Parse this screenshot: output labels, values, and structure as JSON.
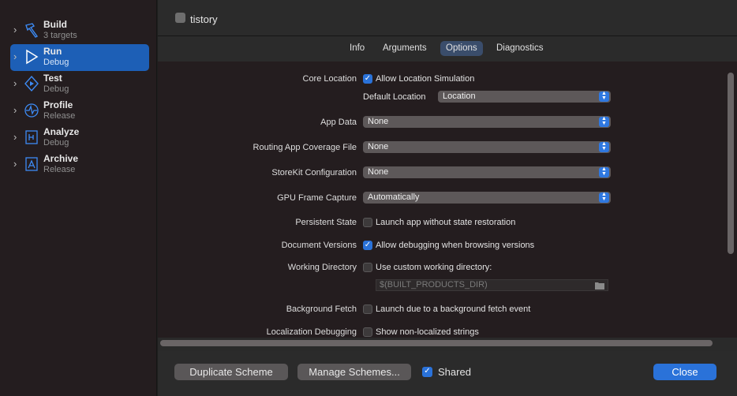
{
  "sidebar": {
    "items": [
      {
        "title": "Build",
        "subtitle": "3 targets",
        "icon": "hammer-icon"
      },
      {
        "title": "Run",
        "subtitle": "Debug",
        "icon": "play-icon"
      },
      {
        "title": "Test",
        "subtitle": "Debug",
        "icon": "test-diamond-icon"
      },
      {
        "title": "Profile",
        "subtitle": "Release",
        "icon": "waveform-icon"
      },
      {
        "title": "Analyze",
        "subtitle": "Debug",
        "icon": "analyze-icon"
      },
      {
        "title": "Archive",
        "subtitle": "Release",
        "icon": "archive-icon"
      }
    ]
  },
  "header": {
    "target_name": "tistory"
  },
  "tabs": [
    "Info",
    "Arguments",
    "Options",
    "Diagnostics"
  ],
  "active_tab": "Options",
  "options": {
    "core_location": {
      "label": "Core Location",
      "checkbox_label": "Allow Location Simulation",
      "checked": true
    },
    "default_location": {
      "label": "Default Location",
      "value": "Location"
    },
    "app_data": {
      "label": "App Data",
      "value": "None"
    },
    "routing": {
      "label": "Routing App Coverage File",
      "value": "None"
    },
    "storekit": {
      "label": "StoreKit Configuration",
      "value": "None"
    },
    "gpu": {
      "label": "GPU Frame Capture",
      "value": "Automatically"
    },
    "persistent": {
      "label": "Persistent State",
      "checkbox_label": "Launch app without state restoration",
      "checked": false
    },
    "document": {
      "label": "Document Versions",
      "checkbox_label": "Allow debugging when browsing versions",
      "checked": true
    },
    "working_dir": {
      "label": "Working Directory",
      "checkbox_label": "Use custom working directory:",
      "checked": false,
      "path_placeholder": "$(BUILT_PRODUCTS_DIR)"
    },
    "background_fetch": {
      "label": "Background Fetch",
      "checkbox_label": "Launch due to a background fetch event",
      "checked": false
    },
    "localization": {
      "label": "Localization Debugging",
      "checkbox_label": "Show non-localized strings",
      "checked": false
    }
  },
  "footer": {
    "duplicate_label": "Duplicate Scheme",
    "manage_label": "Manage Schemes...",
    "shared_label": "Shared",
    "shared_checked": true,
    "close_label": "Close"
  },
  "colors": {
    "accent": "#2a72d9",
    "selection": "#1d5fb6"
  }
}
